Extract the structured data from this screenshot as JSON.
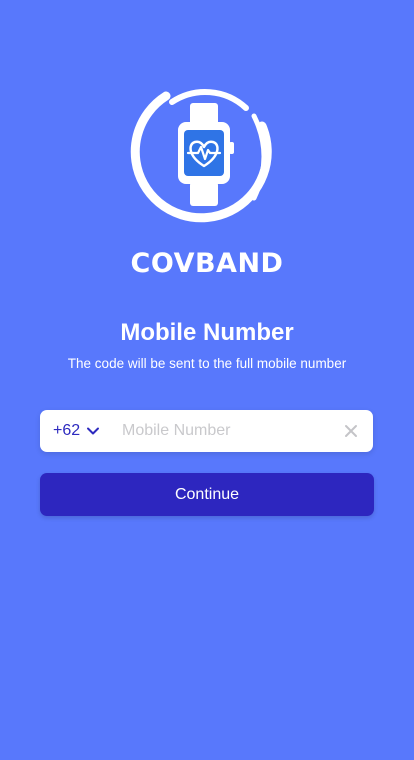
{
  "brand": {
    "name": "COVBAND",
    "logo_icon": "smartwatch-heartbeat-icon"
  },
  "header": {
    "title": "Mobile Number",
    "subtitle": "The code will be sent to the full mobile number"
  },
  "phone": {
    "country_code": "+62",
    "value": "",
    "placeholder": "Mobile Number"
  },
  "actions": {
    "continue_label": "Continue"
  },
  "colors": {
    "background": "#5878FC",
    "primary_button": "#2D26BF",
    "accent_text": "#2D2ABF",
    "white": "#FFFFFF"
  }
}
